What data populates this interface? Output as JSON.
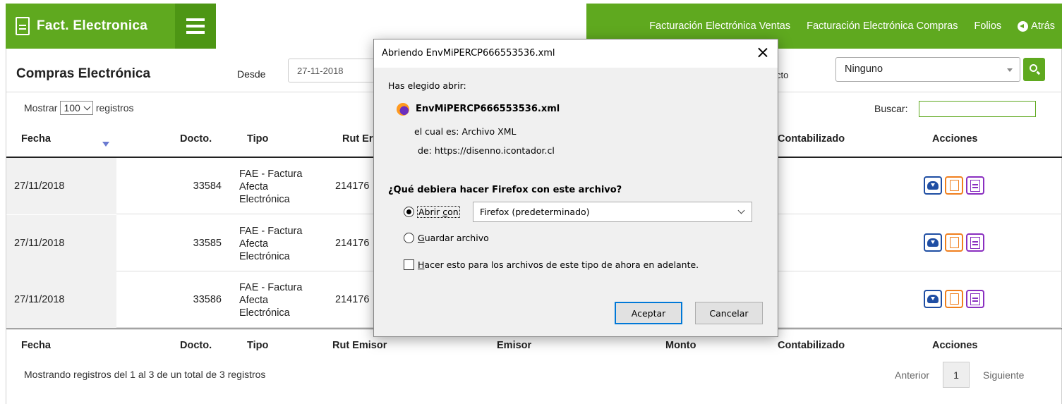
{
  "app": {
    "brand": "Fact. Electronica",
    "nav": [
      "Facturación Electrónica Ventas",
      "Facturación Electrónica Compras",
      "Folios"
    ],
    "back_label": "Atrás"
  },
  "header": {
    "title": "Compras Electrónica",
    "desde_label": "Desde",
    "desde_value": "27-11-2018",
    "cto_label": "cto",
    "select_value": "Ninguno"
  },
  "table_controls": {
    "mostrar": "Mostrar",
    "page_size": "100",
    "registros": "registros",
    "buscar": "Buscar:"
  },
  "columns": {
    "fecha": "Fecha",
    "docto": "Docto.",
    "tipo": "Tipo",
    "rut_short": "Rut Er",
    "rut": "Rut Emisor",
    "emisor": "Emisor",
    "monto": "Monto",
    "contabilizado": "Contabilizado",
    "acciones": "Acciones"
  },
  "rows": [
    {
      "fecha": "27/11/2018",
      "docto": "33584",
      "tipo": [
        "FAE - Factura",
        "Afecta",
        "Electrónica"
      ],
      "rut": "214176"
    },
    {
      "fecha": "27/11/2018",
      "docto": "33585",
      "tipo": [
        "FAE - Factura",
        "Afecta",
        "Electrónica"
      ],
      "rut": "214176"
    },
    {
      "fecha": "27/11/2018",
      "docto": "33586",
      "tipo": [
        "FAE - Factura",
        "Afecta",
        "Electrónica"
      ],
      "rut": "214176"
    }
  ],
  "footer": {
    "info": "Mostrando registros del 1 al 3 de un total de 3 registros",
    "prev": "Anterior",
    "page": "1",
    "next": "Siguiente"
  },
  "dialog": {
    "title": "Abriendo EnvMiPERCP666553536.xml",
    "intro": "Has elegido abrir:",
    "filename": "EnvMiPERCP666553536.xml",
    "cual_es_label": "el cual es:",
    "cual_es_value": "Archivo XML",
    "de_label": "de:",
    "de_value": "https://disenno.icontador.cl",
    "question": "¿Qué debiera hacer Firefox con este archivo?",
    "open_with_label_a": "Abrir ",
    "open_with_label_u": "c",
    "open_with_label_b": "on",
    "open_with_app": "Firefox (predeterminado)",
    "save_label_u": "G",
    "save_label_rest": "uardar archivo",
    "remember_u": "H",
    "remember_rest": "acer esto para los archivos de este tipo de ahora en adelante.",
    "accept": "Aceptar",
    "cancel": "Cancelar"
  },
  "colors": {
    "brand_green": "#5fa91f",
    "dark_green": "#4d9614",
    "cloud_blue": "#1f4ea3",
    "pdf_orange": "#f07f1d",
    "calc_purple": "#8a2fc0"
  }
}
